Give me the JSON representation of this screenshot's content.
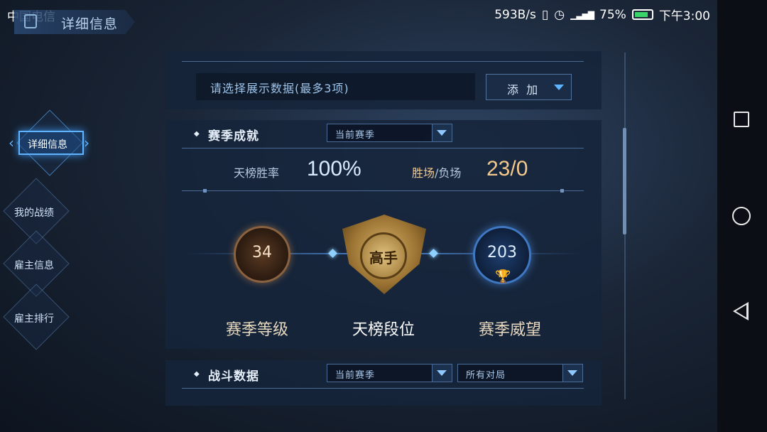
{
  "status_bar": {
    "carrier": "中国电信",
    "speed": "593B/s",
    "battery": "75%",
    "time": "下午3:00"
  },
  "header": {
    "title": "详细信息"
  },
  "sidebar": {
    "items": [
      {
        "label": "详细信息",
        "active": true
      },
      {
        "label": "我的战绩",
        "active": false
      },
      {
        "label": "雇主信息",
        "active": false
      },
      {
        "label": "雇主排行",
        "active": false
      }
    ]
  },
  "display_data": {
    "prompt": "请选择展示数据(最多3项)",
    "add_label": "添 加"
  },
  "season_achievement": {
    "title": "赛季成就",
    "filter": "当前赛季",
    "win_rate_label": "天榜胜率",
    "win_rate_value": "100%",
    "win_loss_label_win": "胜场",
    "win_loss_label_sep": "/负场",
    "win_loss_value": "23/0",
    "level_value": "34",
    "level_label": "赛季等级",
    "rank_value": "高手",
    "rank_label": "天榜段位",
    "prestige_value": "203",
    "prestige_label": "赛季威望"
  },
  "battle_data": {
    "title": "战斗数据",
    "filter_season": "当前赛季",
    "filter_matches": "所有对局"
  },
  "icons": {
    "header": "notebook-icon",
    "back": "chevron-left-icon",
    "prestige": "trophy-icon",
    "android_nav": [
      "recent-apps-icon",
      "home-icon",
      "back-icon"
    ]
  },
  "colors": {
    "accent": "#5fb3ff",
    "gold_text": "#f2c98a",
    "panel": "#16243a"
  }
}
